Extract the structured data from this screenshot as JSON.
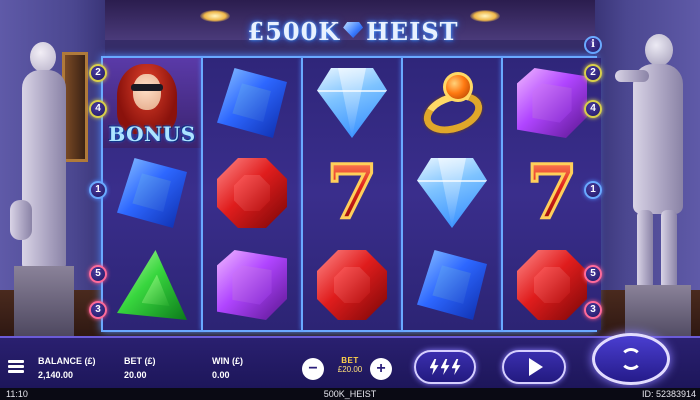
{
  "game": {
    "logo_text_left": "£500K",
    "logo_text_right": "HEIST",
    "info_label": "i"
  },
  "reels": [
    [
      "bonus",
      "blue-gem",
      "green-gem"
    ],
    [
      "blue-gem",
      "red-gem",
      "purple-gem"
    ],
    [
      "diamond",
      "seven",
      "red-gem"
    ],
    [
      "gold-ring",
      "diamond",
      "blue-gem"
    ],
    [
      "purple-gem",
      "seven",
      "red-gem"
    ]
  ],
  "bonus_label": "BONUS",
  "seven_label": "7",
  "paylines": {
    "left": [
      "2",
      "4",
      "1",
      "5",
      "3"
    ],
    "right": [
      "2",
      "4",
      "1",
      "5",
      "3"
    ]
  },
  "bottom_bar": {
    "balance_label": "BALANCE (£)",
    "balance_value": "2,140.00",
    "bet_label": "BET (£)",
    "bet_value": "20.00",
    "win_label": "WIN (£)",
    "win_value": "0.00",
    "bet_selector_title": "BET",
    "bet_selector_value": "£20.00",
    "minus_label": "−",
    "plus_label": "+"
  },
  "status_bar": {
    "time": "11:10",
    "game_name": "500K_HEIST",
    "game_id": "ID: 52383914"
  },
  "colors": {
    "reel_border": "#6aa9ff",
    "bar_bg": "#1d165a",
    "bet_title": "#ffd34a"
  }
}
